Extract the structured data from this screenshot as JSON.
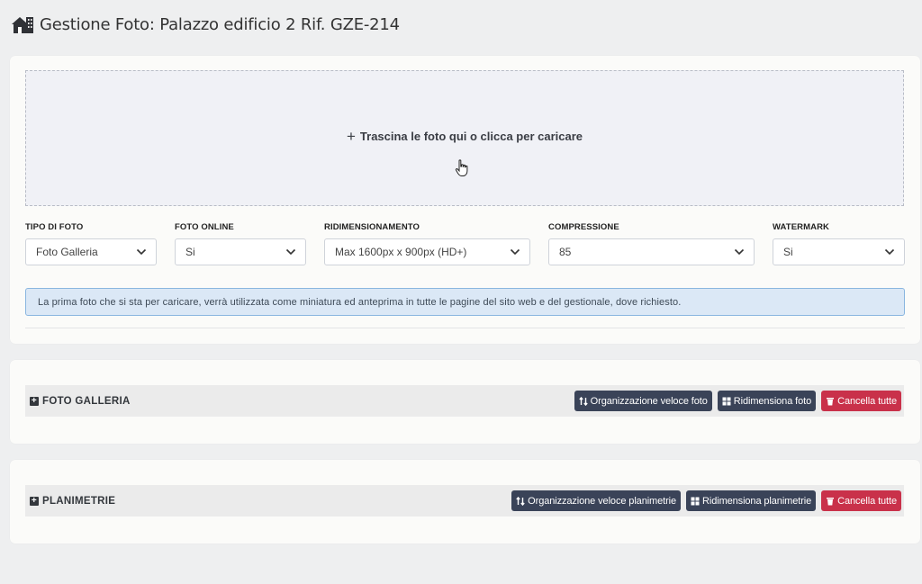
{
  "header": {
    "title": "Gestione Foto: Palazzo edificio 2 Rif. GZE-214"
  },
  "upload": {
    "dropzone_label": "Trascina le foto qui o clicca per caricare",
    "fields": [
      {
        "label": "TIPO DI FOTO",
        "value": "Foto Galleria"
      },
      {
        "label": "FOTO ONLINE",
        "value": "Si"
      },
      {
        "label": "RIDIMENSIONAMENTO",
        "value": "Max 1600px x 900px (HD+)"
      },
      {
        "label": "COMPRESSIONE",
        "value": "85"
      },
      {
        "label": "WATERMARK",
        "value": "Si"
      }
    ],
    "info_text": "La prima foto che si sta per caricare, verrà utilizzata come miniatura ed anteprima in tutte le pagine del sito web e del gestionale, dove richiesto."
  },
  "gallery": {
    "title": "FOTO GALLERIA",
    "buttons": {
      "organize": "Organizzazione veloce foto",
      "resize": "Ridimensiona foto",
      "delete": "Cancella tutte"
    }
  },
  "plans": {
    "title": "PLANIMETRIE",
    "buttons": {
      "organize": "Organizzazione veloce planimetrie",
      "resize": "Ridimensiona planimetrie",
      "delete": "Cancella tutte"
    }
  },
  "colors": {
    "page_bg": "#eeeff0",
    "dark_button": "#3a4358",
    "danger_button": "#c9314a",
    "info_bg": "#dbe8f6",
    "info_border": "#8ab6e0"
  },
  "icons": [
    "house-building-icon",
    "plus-icon",
    "hand-cursor-icon",
    "chevron-down-icon",
    "square-plus-icon",
    "sort-icon",
    "grid-icon",
    "trash-icon"
  ]
}
